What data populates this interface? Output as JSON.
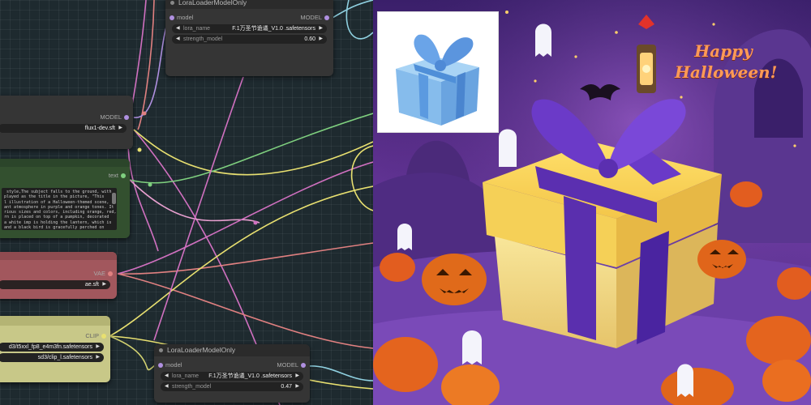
{
  "graph": {
    "lora_top": {
      "title": "LoraLoaderModelOnly",
      "input_label": "model",
      "output_label": "MODEL",
      "lora_name_label": "lora_name",
      "lora_name_value": "F.1万圣节诡谲_V1.0 .safetensors",
      "strength_label": "strength_model",
      "strength_value": "0.60"
    },
    "unet_loader": {
      "output_label": "MODEL",
      "unet_value": "flux1-dev.sft"
    },
    "text_encode": {
      "output_label": "text",
      "prompt_text": " style,The subject falls to the ground, with\nplayed as the title in the picture, \"This\nl illustration of a Halloween-themed scene,\nant atmosphere in purple and orange tones. It\nrious sizes and colors, including orange, red,\nrn is placed on top of a pumpkin, decorated\na white imp is holding the lantern, which is\nand a black bird is gracefully perched on"
    },
    "vae_loader": {
      "output_label": "VAE",
      "vae_value": "ae.sft"
    },
    "clip_loader": {
      "output_label": "CLIP",
      "clip1_value": "d3/t5xxl_fp8_e4m3fn.safetensors",
      "clip2_value": "sd3/clip_l.safetensors"
    },
    "lora_bottom": {
      "title": "LoraLoaderModelOnly",
      "input_label": "model",
      "output_label": "MODEL",
      "lora_name_label": "lora_name",
      "lora_name_value": "F.1万圣节诡谲_V1.0 .safetensors",
      "strength_label": "strength_model",
      "strength_value": "0.47"
    }
  },
  "preview": {
    "greeting_line1": "Happy",
    "greeting_line2": "Halloween!"
  },
  "colors": {
    "wire_pink": "#d070c0",
    "wire_yellow": "#e8e070",
    "wire_cyan": "#8fd0e0",
    "wire_green": "#7fd07f",
    "wire_lavender": "#b090e0",
    "wire_salmon": "#e08080"
  }
}
